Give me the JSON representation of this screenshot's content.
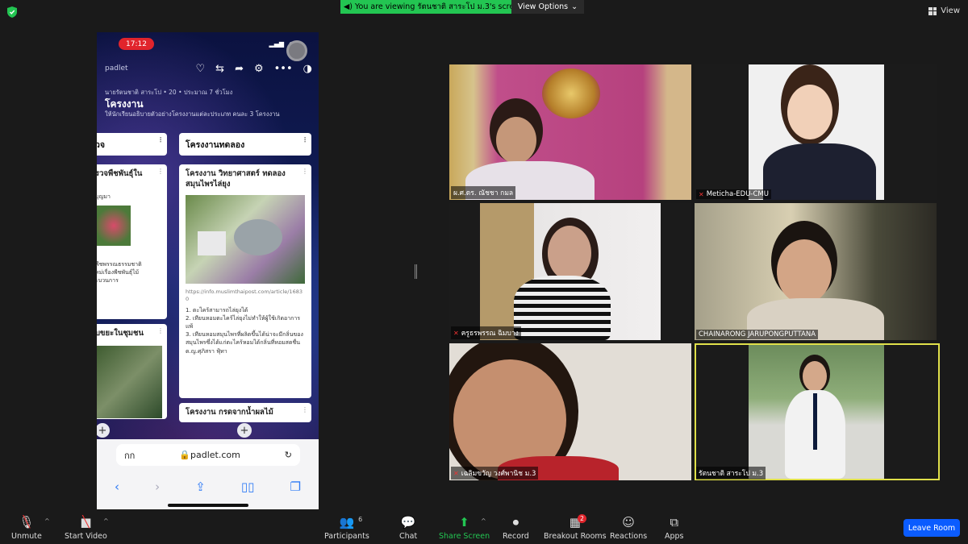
{
  "banner": {
    "viewing_text": "You are viewing รัตนชาติ สาระโป ม.3's screen",
    "view_options": "View Options",
    "view_label": "View"
  },
  "phone": {
    "time": "17:12",
    "brand": "padlet",
    "meta": "นายรัตนชาติ สาระโป  •  20  •  ประมาณ 7 ชั่วโมง",
    "title": "โครงงาน",
    "subtitle": "ให้นักเรียนอธิบายตัวอย่างโครงงานแต่ละประเภท คนละ 3 โครงงาน",
    "left_column": {
      "header": "วจ",
      "card1_title": "รวจพืชพันธุ์ใน",
      "card1_small": "บุญมา",
      "card1_body": "พืชพรรณธรรมชาติ\nหม่เรื่องพืชพันธุ์ไม้\nะบวนการ",
      "card2_title": "บขยะในชุมชน"
    },
    "right_column": {
      "header": "โครงงานทดลอง",
      "card1_title": "โครงงาน วิทยาศาสตร์ ทดลอง สมุนไพรไล่ยุง",
      "card1_link": "https://info.muslimthaipost.com/article/16830",
      "card1_body": [
        "1. ตะไคร้สามารถไล่ยุงได้",
        "2. เทียนหอมตะไคร้ไล่ยุงไม่ทำให้ผู้ใช้เกิดอาการแพ้",
        "3. เทียนหอมสมุนไพรที่ผลิตขึ้นได้น่าจะมีกลิ่นของสมุนไพรซึ่งได้แก่ตะไคร้หอมได้กลิ่นที่หอมสดชื่น",
        "ด.ญ.ศุภิสรา ฟุ้ทา"
      ],
      "card2_title": "โครงงาน กรดจากน้ำผลไม้"
    },
    "url_left": "กก",
    "url": "padlet.com"
  },
  "participants": [
    {
      "name": "ผ.ศ.ดร. ณัชชา กมล",
      "muted": false
    },
    {
      "name": "Meticha-EDU-CMU",
      "muted": true
    },
    {
      "name": "ครูธรพรรณ ฉิมบาง",
      "muted": true
    },
    {
      "name": "CHAINARONG JARUPONGPUTTANA",
      "muted": false
    },
    {
      "name": "เฉลิมขวัญ  วงศ์พานิช ม.3",
      "muted": true
    },
    {
      "name": "รัตนชาติ สาระโป ม.3",
      "muted": false
    }
  ],
  "toolbar": {
    "unmute": "Unmute",
    "start_video": "Start Video",
    "participants": "Participants",
    "participants_count": "6",
    "chat": "Chat",
    "share_screen": "Share Screen",
    "record": "Record",
    "breakout_rooms": "Breakout Rooms",
    "breakout_badge": "2",
    "reactions": "Reactions",
    "apps": "Apps",
    "leave_room": "Leave Room"
  },
  "colors": {
    "banner_green": "#23c552",
    "leave_blue": "#0b5cff",
    "active_speaker": "#e0e04a",
    "badge_red": "#e0242b"
  }
}
